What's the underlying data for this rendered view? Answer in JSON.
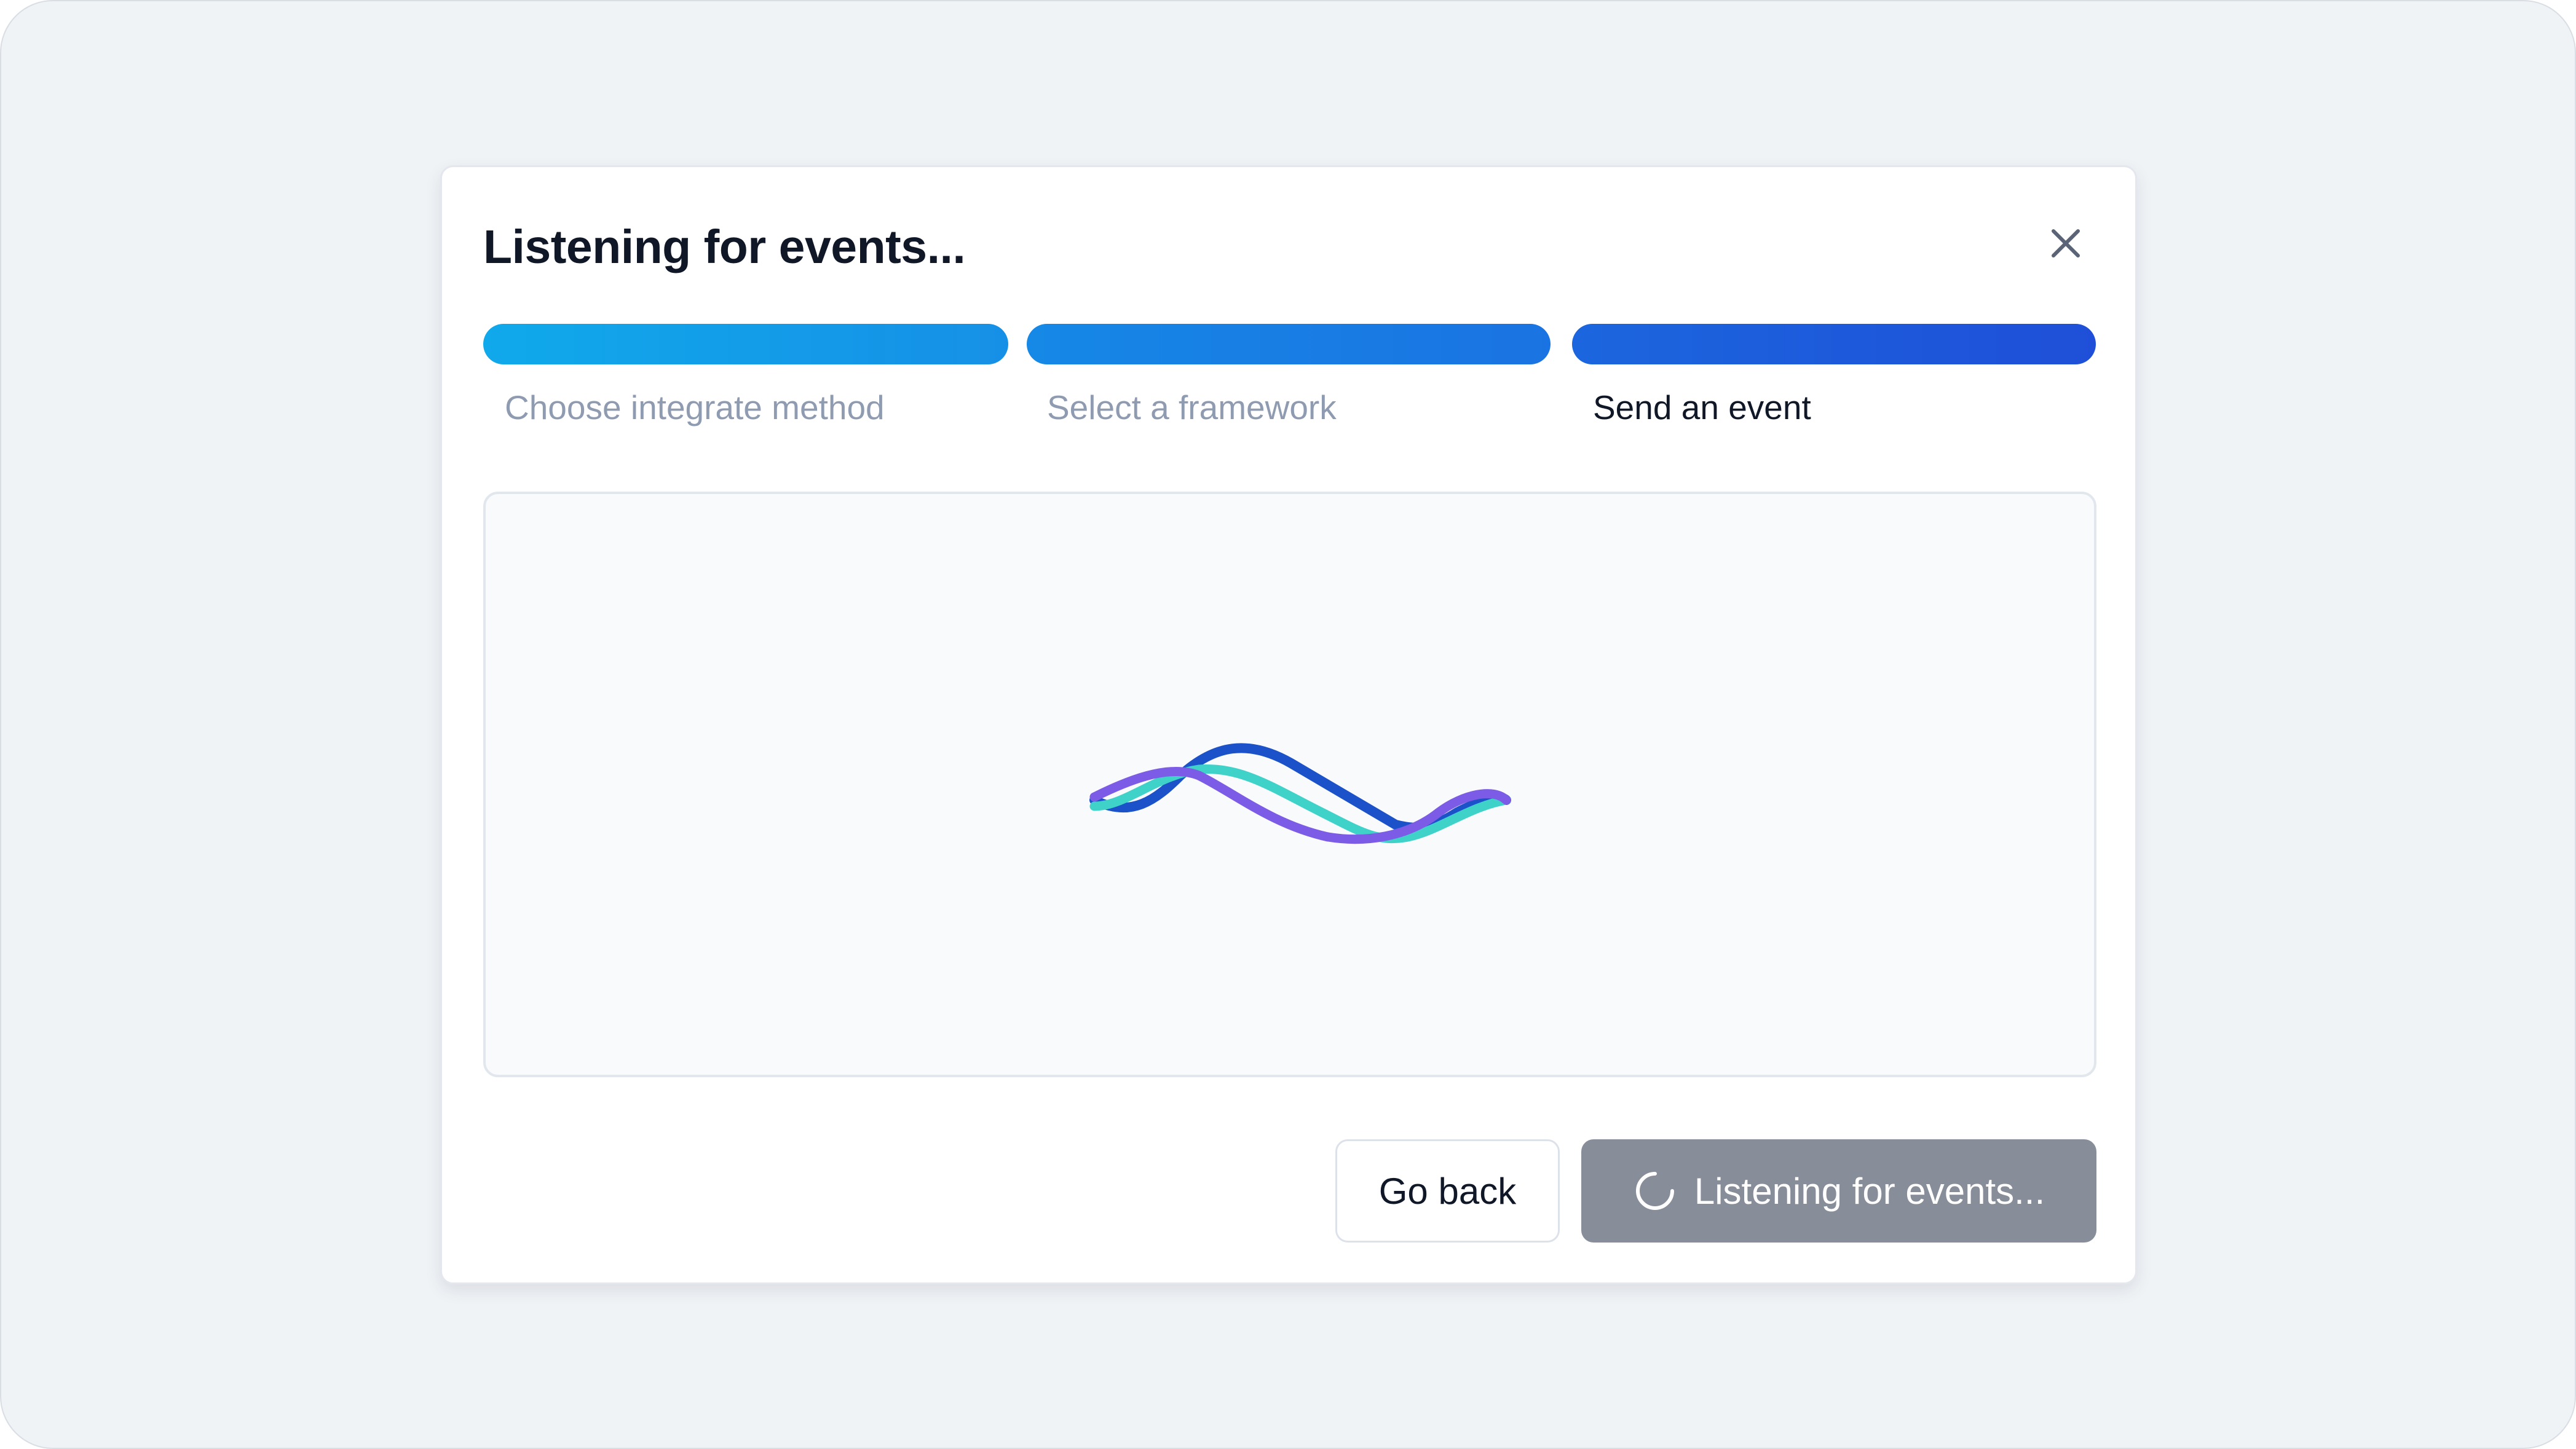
{
  "modal": {
    "title": "Listening for events..."
  },
  "steps": [
    {
      "label": "Choose integrate method",
      "status": "complete"
    },
    {
      "label": "Select a framework",
      "status": "complete"
    },
    {
      "label": "Send an event",
      "status": "current"
    }
  ],
  "actions": {
    "back_label": "Go back",
    "listening_label": "Listening for events..."
  },
  "icons": {
    "close": "close-icon",
    "spinner": "loading-spinner-icon",
    "illustration": "waveform-animation"
  },
  "colors": {
    "step_gradient_start": "#10a9eb",
    "step_gradient_end": "#1f4fd8",
    "wave_blue": "#1b52c9",
    "wave_teal": "#3fd2c8",
    "wave_purple": "#7c5ce6",
    "disabled_button": "#878d99"
  }
}
